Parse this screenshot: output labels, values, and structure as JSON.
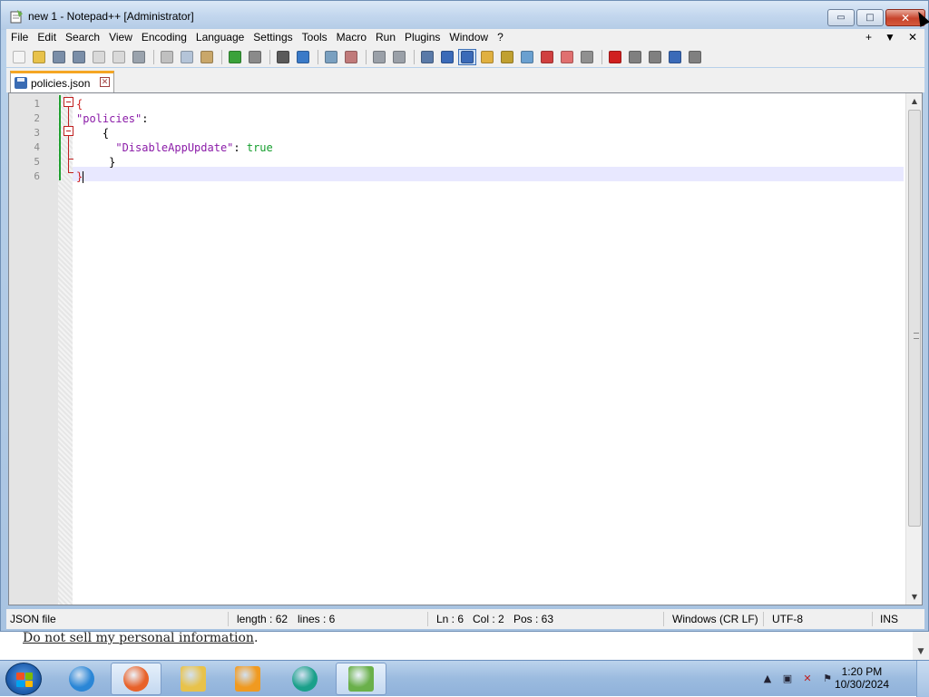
{
  "window": {
    "title": "new 1 - Notepad++ [Administrator]",
    "minimize_glyph": "▭",
    "maximize_glyph": "□",
    "close_glyph": "✕"
  },
  "menu": {
    "items": [
      "File",
      "Edit",
      "Search",
      "View",
      "Encoding",
      "Language",
      "Settings",
      "Tools",
      "Macro",
      "Run",
      "Plugins",
      "Window",
      "?"
    ],
    "right": [
      "+",
      "▼",
      "✕"
    ]
  },
  "toolbar": {
    "icons": [
      {
        "name": "new-file-icon",
        "color": "#f4f4f4"
      },
      {
        "name": "open-file-icon",
        "color": "#e8c24a"
      },
      {
        "name": "save-icon",
        "color": "#7a8ea8"
      },
      {
        "name": "save-all-icon",
        "color": "#7a8ea8"
      },
      {
        "name": "close-icon",
        "color": "#d9d9d9"
      },
      {
        "name": "close-all-icon",
        "color": "#d9d9d9"
      },
      {
        "name": "print-icon",
        "color": "#9aa3ad"
      },
      {
        "sep": true
      },
      {
        "name": "cut-icon",
        "color": "#c0c0c0"
      },
      {
        "name": "copy-icon",
        "color": "#b4c4d8"
      },
      {
        "name": "paste-icon",
        "color": "#c9a76a"
      },
      {
        "sep": true
      },
      {
        "name": "undo-icon",
        "color": "#3aa23a"
      },
      {
        "name": "redo-icon",
        "color": "#8a8a8a"
      },
      {
        "sep": true
      },
      {
        "name": "find-icon",
        "color": "#5a5a5a"
      },
      {
        "name": "replace-icon",
        "color": "#3a7ac8"
      },
      {
        "sep": true
      },
      {
        "name": "zoom-in-icon",
        "color": "#7aa0c0"
      },
      {
        "name": "zoom-out-icon",
        "color": "#c07a7a"
      },
      {
        "sep": true
      },
      {
        "name": "sync-vertical-icon",
        "color": "#9aa0a8"
      },
      {
        "name": "sync-horizontal-icon",
        "color": "#9aa0a8"
      },
      {
        "sep": true
      },
      {
        "name": "word-wrap-icon",
        "color": "#5a7aa8"
      },
      {
        "name": "show-all-chars-icon",
        "color": "#3a6ab8"
      },
      {
        "name": "indent-guide-icon",
        "color": "#3a6ab8",
        "active": true
      },
      {
        "name": "user-language-icon",
        "color": "#e0b040"
      },
      {
        "name": "doc-map-icon",
        "color": "#c0a030"
      },
      {
        "name": "function-list-icon",
        "color": "#6aa0d0"
      },
      {
        "name": "folder-workspace-icon",
        "color": "#d04040"
      },
      {
        "name": "monitoring-icon",
        "color": "#e07070"
      },
      {
        "name": "eye-icon",
        "color": "#909090"
      },
      {
        "sep": true
      },
      {
        "name": "record-macro-icon",
        "color": "#d02020"
      },
      {
        "name": "stop-record-icon",
        "color": "#808080"
      },
      {
        "name": "play-macro-icon",
        "color": "#808080"
      },
      {
        "name": "run-macro-multiple-icon",
        "color": "#3a6ab8"
      },
      {
        "name": "save-macro-icon",
        "color": "#808080"
      }
    ]
  },
  "tab": {
    "label": "policies.json",
    "close_glyph": "✕"
  },
  "editor": {
    "line_numbers": [
      "1",
      "2",
      "3",
      "4",
      "5",
      "6"
    ],
    "lines": [
      [
        {
          "t": "{",
          "c": "brace-hl"
        }
      ],
      [
        {
          "t": "\"policies\"",
          "c": "str"
        },
        {
          "t": ":",
          "c": "punct"
        }
      ],
      [
        {
          "t": "    {",
          "c": "punct"
        }
      ],
      [
        {
          "t": "      \"DisableAppUpdate\"",
          "c": "str"
        },
        {
          "t": ": ",
          "c": "punct"
        },
        {
          "t": "true",
          "c": "bool"
        }
      ],
      [
        {
          "t": "     }",
          "c": "punct"
        }
      ],
      [
        {
          "t": "}",
          "c": "brace-hl"
        }
      ]
    ]
  },
  "status": {
    "file_type": "JSON file",
    "length": "length : 62",
    "lines": "lines : 6",
    "ln": "Ln : 6",
    "col": "Col : 2",
    "pos": "Pos : 63",
    "eol": "Windows (CR LF)",
    "encoding": "UTF-8",
    "mode": "INS"
  },
  "background": {
    "link_text": "Do not sell my personal information",
    "trailing": "."
  },
  "taskbar": {
    "apps": [
      {
        "name": "internet-explorer-icon",
        "color": "#2a86d6",
        "active": false
      },
      {
        "name": "firefox-icon",
        "color": "#e8622a",
        "active": true
      },
      {
        "name": "file-explorer-icon",
        "color": "#e8c24a",
        "active": false
      },
      {
        "name": "media-player-icon",
        "color": "#f09a20",
        "active": false
      },
      {
        "name": "app-icon",
        "color": "#1aa08a",
        "active": false
      },
      {
        "name": "notepadpp-icon",
        "color": "#6ab04a",
        "active": true
      }
    ],
    "time": "1:20 PM",
    "date": "10/30/2024"
  }
}
